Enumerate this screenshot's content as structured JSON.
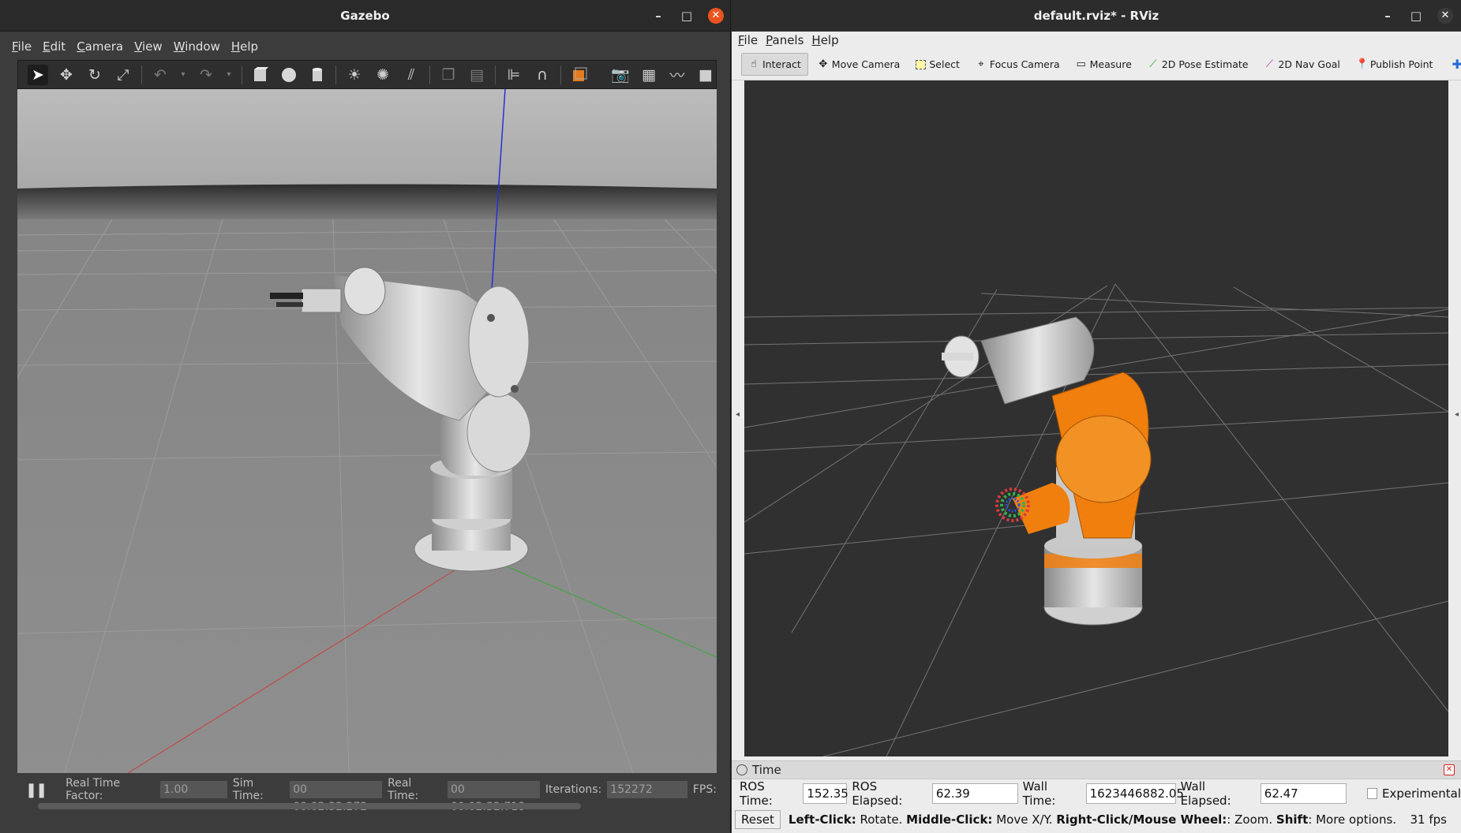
{
  "gazebo": {
    "title": "Gazebo",
    "menu": [
      "File",
      "Edit",
      "Camera",
      "View",
      "Window",
      "Help"
    ],
    "toolbar_icons": [
      "select-arrow-icon",
      "translate-icon",
      "rotate-icon",
      "scale-icon",
      "undo-icon",
      "undo-dropdown-icon",
      "redo-icon",
      "redo-dropdown-icon",
      "box-icon",
      "sphere-icon",
      "cylinder-icon",
      "point-light-icon",
      "spot-light-icon",
      "directional-light-icon",
      "copy-icon",
      "paste-icon",
      "align-icon",
      "snap-icon",
      "view-angle-icon",
      "screenshot-icon",
      "log-icon",
      "plot-icon",
      "video-record-icon"
    ],
    "status": {
      "real_time_factor_label": "Real Time Factor:",
      "real_time_factor": "1.00",
      "sim_time_label": "Sim Time:",
      "sim_time": "00 00:02:32.272",
      "real_time_label": "Real Time:",
      "real_time": "00 00:02:32.718",
      "iterations_label": "Iterations:",
      "iterations": "152272",
      "fps_label": "FPS:"
    }
  },
  "rviz": {
    "title": "default.rviz* - RViz",
    "menu": [
      "File",
      "Panels",
      "Help"
    ],
    "tools": [
      {
        "label": "Interact",
        "icon": "hand-icon"
      },
      {
        "label": "Move Camera",
        "icon": "move-camera-icon"
      },
      {
        "label": "Select",
        "icon": "select-box-icon"
      },
      {
        "label": "Focus Camera",
        "icon": "focus-camera-icon"
      },
      {
        "label": "Measure",
        "icon": "ruler-icon"
      },
      {
        "label": "2D Pose Estimate",
        "icon": "pose-estimate-arrow-icon"
      },
      {
        "label": "2D Nav Goal",
        "icon": "nav-goal-arrow-icon"
      },
      {
        "label": "Publish Point",
        "icon": "map-pin-icon"
      }
    ],
    "time_panel": {
      "title": "Time",
      "ros_time_label": "ROS Time:",
      "ros_time": "152.35",
      "ros_elapsed_label": "ROS Elapsed:",
      "ros_elapsed": "62.39",
      "wall_time_label": "Wall Time:",
      "wall_time": "1623446882.05",
      "wall_elapsed_label": "Wall Elapsed:",
      "wall_elapsed": "62.47",
      "experimental_label": "Experimental"
    },
    "help": {
      "reset_label": "Reset",
      "left_click": "Left-Click:",
      "left_click_desc": "Rotate.",
      "middle_click": "Middle-Click:",
      "middle_click_desc": "Move X/Y.",
      "right_click": "Right-Click/Mouse Wheel:",
      "right_click_desc": ": Zoom.",
      "shift": "Shift",
      "shift_desc": ": More options."
    },
    "fps": "31 fps",
    "colors": {
      "robot_orange": "#f07f0e",
      "viewport_bg": "#303030"
    }
  }
}
